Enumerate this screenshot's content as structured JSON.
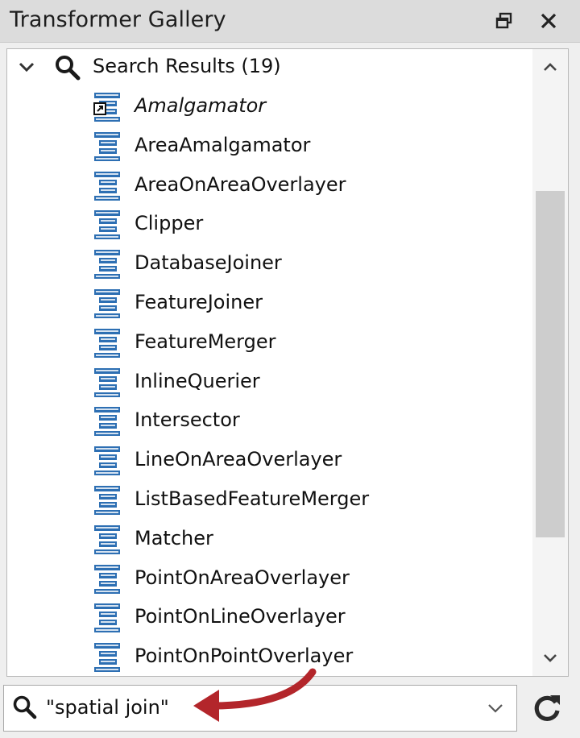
{
  "panel": {
    "title": "Transformer Gallery"
  },
  "tree": {
    "header_label": "Search Results (19)",
    "items": [
      {
        "label": "Amalgamator",
        "italic": true,
        "icon": "custom-transformer-icon"
      },
      {
        "label": "AreaAmalgamator",
        "italic": false,
        "icon": "transformer-icon"
      },
      {
        "label": "AreaOnAreaOverlayer",
        "italic": false,
        "icon": "transformer-icon"
      },
      {
        "label": "Clipper",
        "italic": false,
        "icon": "transformer-icon"
      },
      {
        "label": "DatabaseJoiner",
        "italic": false,
        "icon": "transformer-icon"
      },
      {
        "label": "FeatureJoiner",
        "italic": false,
        "icon": "transformer-icon"
      },
      {
        "label": "FeatureMerger",
        "italic": false,
        "icon": "transformer-icon"
      },
      {
        "label": "InlineQuerier",
        "italic": false,
        "icon": "transformer-icon"
      },
      {
        "label": "Intersector",
        "italic": false,
        "icon": "transformer-icon"
      },
      {
        "label": "LineOnAreaOverlayer",
        "italic": false,
        "icon": "transformer-icon"
      },
      {
        "label": "ListBasedFeatureMerger",
        "italic": false,
        "icon": "transformer-icon"
      },
      {
        "label": "Matcher",
        "italic": false,
        "icon": "transformer-icon"
      },
      {
        "label": "PointOnAreaOverlayer",
        "italic": false,
        "icon": "transformer-icon"
      },
      {
        "label": "PointOnLineOverlayer",
        "italic": false,
        "icon": "transformer-icon"
      },
      {
        "label": "PointOnPointOverlayer",
        "italic": false,
        "icon": "transformer-icon"
      }
    ]
  },
  "search": {
    "value": "\"spatial join\""
  },
  "colors": {
    "icon_blue": "#2d6fb3",
    "arrow_red": "#b3262b"
  }
}
